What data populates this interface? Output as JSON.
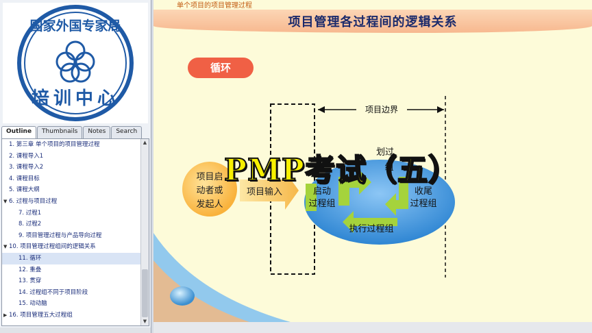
{
  "logo": {
    "ring_text": "国家外国专家局",
    "center_text": "培训中心",
    "color": "#1f5aa6"
  },
  "tabs": [
    {
      "label": "Outline",
      "active": true
    },
    {
      "label": "Thumbnails",
      "active": false
    },
    {
      "label": "Notes",
      "active": false
    },
    {
      "label": "Search",
      "active": false
    }
  ],
  "outline": [
    {
      "label": "1. 第三章 单个项目的项目管理过程",
      "level": 1,
      "expand": ""
    },
    {
      "label": "2. 课程导入1",
      "level": 1,
      "expand": ""
    },
    {
      "label": "3. 课程导入2",
      "level": 1,
      "expand": ""
    },
    {
      "label": "4. 课程目标",
      "level": 1,
      "expand": ""
    },
    {
      "label": "5. 课程大纲",
      "level": 1,
      "expand": ""
    },
    {
      "label": "6. 过程与项目过程",
      "level": 1,
      "expand": "▼"
    },
    {
      "label": "7. 过程1",
      "level": 2,
      "expand": ""
    },
    {
      "label": "8. 过程2",
      "level": 2,
      "expand": ""
    },
    {
      "label": "9. 项目管理过程与产品导向过程",
      "level": 2,
      "expand": ""
    },
    {
      "label": "10. 项目管理过程组间的逻辑关系",
      "level": 1,
      "expand": "▼"
    },
    {
      "label": "11. 循环",
      "level": 2,
      "expand": "",
      "selected": true
    },
    {
      "label": "12. 重叠",
      "level": 2,
      "expand": ""
    },
    {
      "label": "13. 贯穿",
      "level": 2,
      "expand": ""
    },
    {
      "label": "14. 过程组不同于项目阶段",
      "level": 2,
      "expand": ""
    },
    {
      "label": "15. 动动脑",
      "level": 2,
      "expand": ""
    },
    {
      "label": "16. 项目管理五大过程组",
      "level": 1,
      "expand": "▶"
    }
  ],
  "slide": {
    "subtitle": "单个项目的项目管理过程",
    "title": "项目管理各过程间的逻辑关系",
    "section_pill": "循环",
    "boundary_label": "项目边界",
    "initiator_line1": "项目启",
    "initiator_line2": "动者或",
    "initiator_line3": "发起人",
    "input_label": "项目输入",
    "start_line1": "启动",
    "start_line2": "过程组",
    "close_line1": "收尾",
    "close_line2": "过程组",
    "exec_label": "执行过程组",
    "plan_partial_line1": "划过",
    "plan_partial_line2": "组"
  },
  "overlay_title": "PMP考试（五）",
  "colors": {
    "pill": "#f06045",
    "overlay": "#f7f000",
    "ellipse": "#3d8fd6",
    "arrow": "#9acd32"
  }
}
